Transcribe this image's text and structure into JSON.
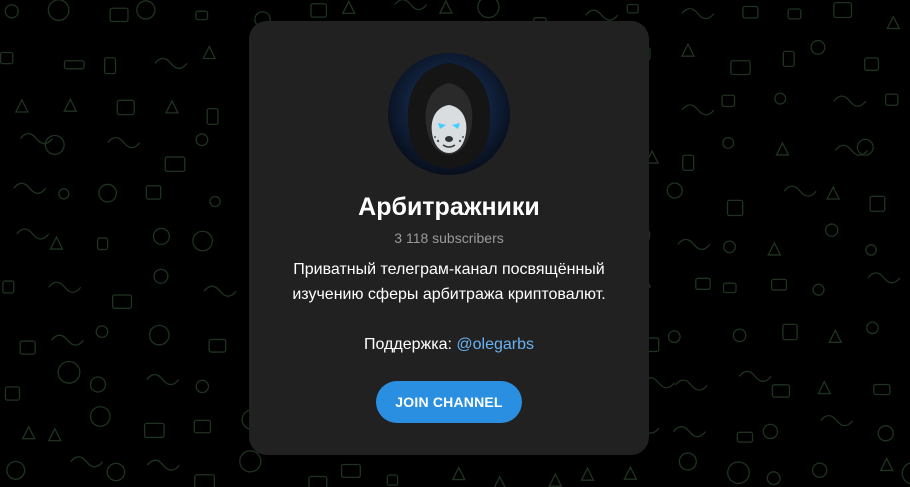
{
  "channel": {
    "title": "Арбитражники",
    "subscribers": "3 118 subscribers",
    "description_line1": "Приватный телеграм-канал посвящённый",
    "description_line2": "изучению сферы арбитража криптовалют.",
    "support_label": "Поддержка:",
    "support_handle": "@olegarbs",
    "avatar_icon": "hooded-cat-icon"
  },
  "actions": {
    "join_label": "JOIN CHANNEL"
  },
  "colors": {
    "background": "#000000",
    "card": "#212121",
    "accent": "#2a8fe0",
    "link": "#6ab3f3",
    "muted": "#9a9a9a",
    "doodle": "#1f3320"
  }
}
